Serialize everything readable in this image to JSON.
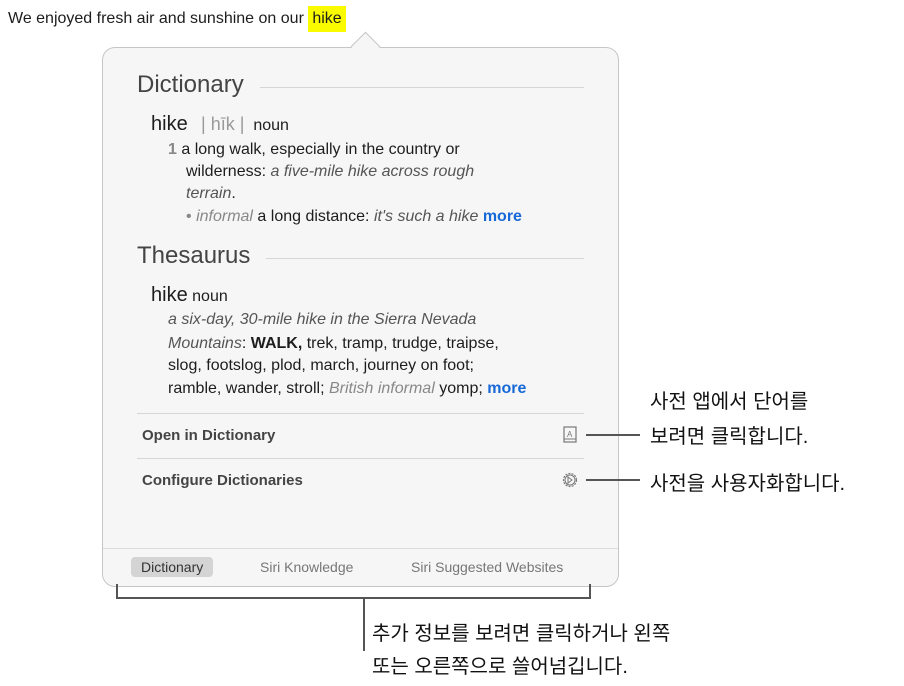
{
  "sentence": {
    "before": "We enjoyed fresh air and sunshine on our ",
    "highlight": "hike"
  },
  "dictionary": {
    "heading": "Dictionary",
    "headword": "hike",
    "pronunciation": "| hīk |",
    "pos": "noun",
    "sense_number": "1",
    "def_line1": "a long walk, especially in the country or",
    "def_line2_plain": "wilderness: ",
    "def_line2_example": "a five-mile hike across rough",
    "def_line3_example": "terrain",
    ".": ".",
    "sub_label": "informal",
    "sub_def": " a long distance: ",
    "sub_example": "it's such a hike ",
    "more": "more"
  },
  "thesaurus": {
    "heading": "Thesaurus",
    "headword": "hike",
    "pos": "noun",
    "line1": "a six-day, 30-mile hike in the Sierra Nevada",
    "line2_example": "Mountains",
    "line2_colon": ": ",
    "line2_bold": "WALK,",
    "line2_rest": " trek, tramp, trudge, traipse,",
    "line3": "slog, footslog, plod, march, journey on foot;",
    "line4_plain": "ramble, wander, stroll; ",
    "line4_label": "British informal",
    "line4_rest": " yomp; ",
    "more": "more"
  },
  "actions": [
    {
      "label": "Open in Dictionary",
      "icon": "dictionary-book-icon"
    },
    {
      "label": "Configure Dictionaries",
      "icon": "gear-icon"
    }
  ],
  "tabs": [
    {
      "label": "Dictionary",
      "selected": true
    },
    {
      "label": "Siri Knowledge"
    },
    {
      "label": "Siri Suggested Websites"
    }
  ],
  "callouts": {
    "open_line1": "사전 앱에서 단어를",
    "open_line2": "보려면 클릭합니다.",
    "configure": "사전을 사용자화합니다.",
    "tabs_line1": "추가 정보를 보려면 클릭하거나 왼쪽",
    "tabs_line2": "또는 오른쪽으로 쓸어넘깁니다."
  }
}
